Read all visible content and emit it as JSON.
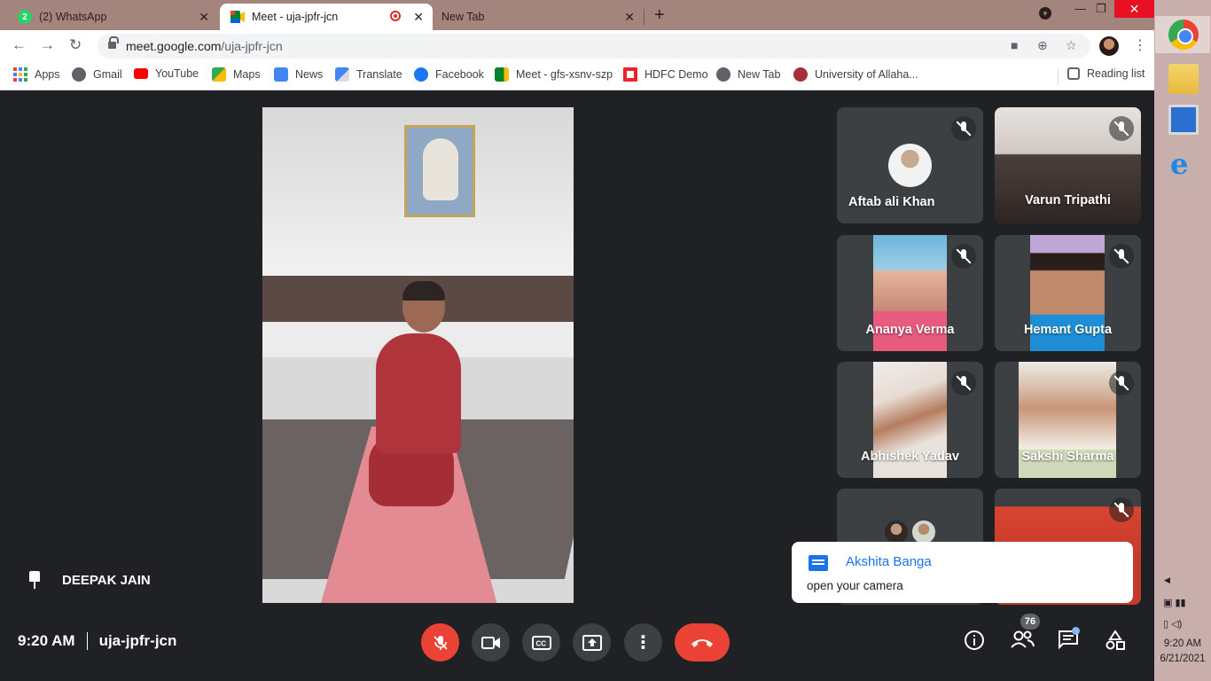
{
  "browser": {
    "tabs": [
      {
        "title": "(2) WhatsApp",
        "badge": "2"
      },
      {
        "title": "Meet - uja-jpfr-jcn"
      },
      {
        "title": "New Tab"
      }
    ],
    "url_host": "meet.google.com",
    "url_path": "/uja-jpfr-jcn",
    "bookmarks": [
      "Apps",
      "Gmail",
      "YouTube",
      "Maps",
      "News",
      "Translate",
      "Facebook",
      "Meet - gfs-xsnv-szp",
      "HDFC Demo",
      "New Tab",
      "University of Allaha..."
    ],
    "reading_list": "Reading list"
  },
  "meet": {
    "pinned_name": "DEEPAK JAIN",
    "participants": [
      "Aftab ali Khan",
      "Varun Tripathi",
      "Ananya Verma",
      "Hemant Gupta",
      "Abhishek Yadav",
      "Sakshi Sharma"
    ],
    "chat_toast": {
      "sender": "Akshita Banga",
      "message": "open your camera"
    },
    "time": "9:20 AM",
    "meeting_code": "uja-jpfr-jcn",
    "people_count": "76"
  },
  "taskbar": {
    "time": "9:20 AM",
    "date": "6/21/2021"
  },
  "colors": {
    "accent": "#1a73e8",
    "danger": "#ea4335",
    "meet_bg": "#202124",
    "tabstrip": "#a4857e"
  }
}
